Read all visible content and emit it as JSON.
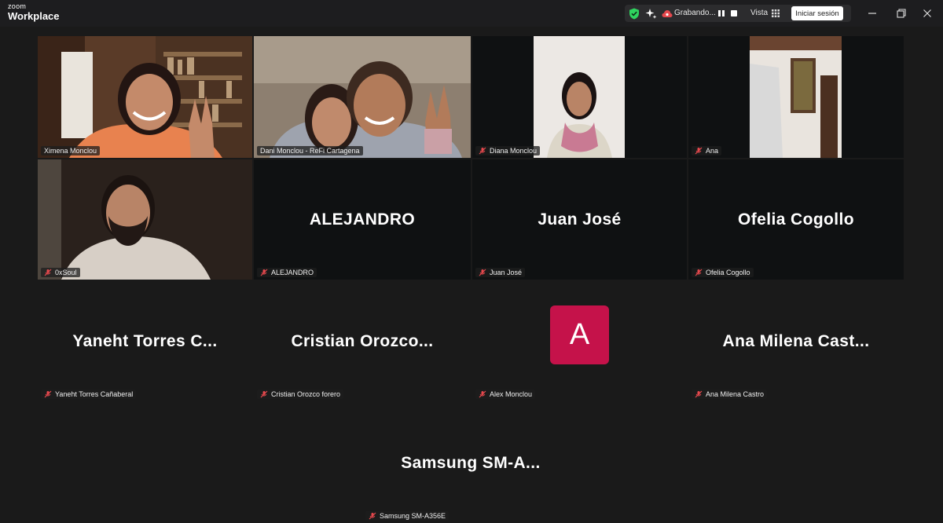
{
  "app": {
    "brand_line1": "zoom",
    "brand_line2": "Workplace"
  },
  "toolbar": {
    "recording_label": "Grabando...",
    "view_label": "Vista",
    "signin_label": "Iniciar sesión"
  },
  "participants": [
    {
      "id": "ximena",
      "label": "Ximena Monclou",
      "muted": false,
      "video": true
    },
    {
      "id": "dani",
      "label": "Dani Monclou - ReFi Cartagena",
      "muted": false,
      "video": true,
      "speaking": true
    },
    {
      "id": "diana",
      "label": "Diana Monclou",
      "muted": true,
      "video": true
    },
    {
      "id": "ana",
      "label": "Ana",
      "muted": true,
      "video": true
    },
    {
      "id": "0xsoul",
      "label": "0xSoul",
      "muted": true,
      "video": true
    },
    {
      "id": "alejandro",
      "label": "ALEJANDRO",
      "display_name": "ALEJANDRO",
      "muted": true,
      "video": false
    },
    {
      "id": "juanjose",
      "label": "Juan José",
      "display_name": "Juan José",
      "muted": true,
      "video": false
    },
    {
      "id": "ofelia",
      "label": "Ofelia Cogollo",
      "display_name": "Ofelia Cogollo",
      "muted": true,
      "video": false
    },
    {
      "id": "yaneht",
      "label": "Yaneht Torres Cañaberal",
      "display_name": "Yaneht Torres C...",
      "muted": true,
      "video": false
    },
    {
      "id": "cristian",
      "label": "Cristian Orozco forero",
      "display_name": "Cristian Orozco...",
      "muted": true,
      "video": false
    },
    {
      "id": "alex",
      "label": "Alex Monclou",
      "avatar_letter": "A",
      "avatar_color": "#c5124a",
      "muted": true,
      "video": false
    },
    {
      "id": "anamilena",
      "label": "Ana Milena Castro",
      "display_name": "Ana Milena Cast...",
      "muted": true,
      "video": false
    },
    {
      "id": "samsung",
      "label": "Samsung SM-A356E",
      "display_name": "Samsung SM-A...",
      "muted": true,
      "video": false
    }
  ],
  "colors": {
    "speaking_outline": "#2fd35f",
    "muted_icon": "#e5484d",
    "shield": "#2fd35f",
    "recording": "#e5484d"
  }
}
